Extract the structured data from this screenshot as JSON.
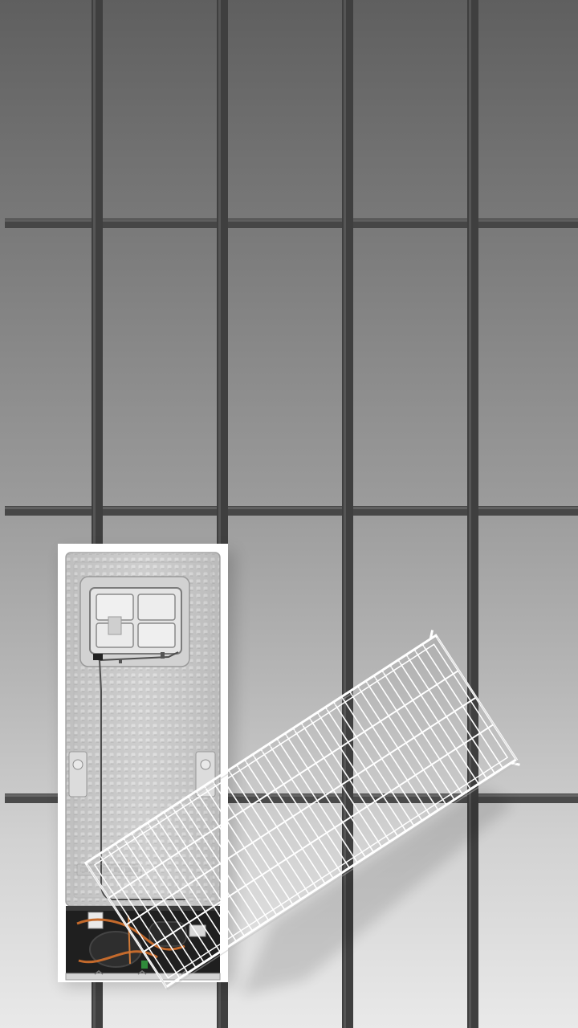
{
  "scene": {
    "subject": "product-photo",
    "colors": {
      "bar": "#414141",
      "bar_highlight": "#5a5a5a",
      "fridge_panel": "#cfcfcf",
      "fridge_frame": "#ffffff",
      "compressor_bay": "#1c1c1c",
      "copper_pipe": "#c46a2c",
      "shelf_wire": "#ffffff"
    }
  }
}
